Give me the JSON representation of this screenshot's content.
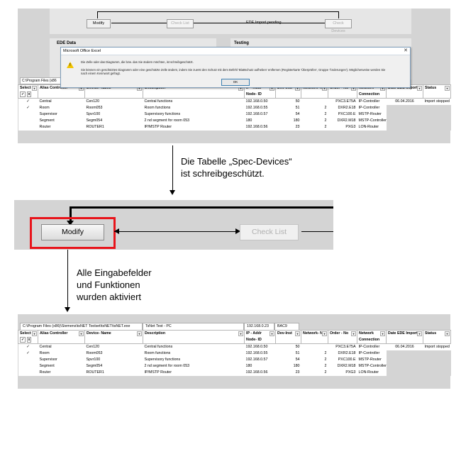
{
  "panel1": {
    "workflow": {
      "modify_label": "Modify",
      "checklist_label": "Check List",
      "ede_status_label": "EDE Import pending",
      "check_devices_label": "Check Devices"
    },
    "ede_data_label": "EDE Data",
    "testing_label": "Testing",
    "path_prefix": "C:\\Program Files (x86",
    "dialog": {
      "title": "Microsoft Office Excel",
      "message_line1": "Die Zelle oder das Diagramm, die bzw. das Sie ändern möchten, ist schreibgeschützt.",
      "message_line2": "Sie können ein geschütztes Diagramm oder eine geschützte Zelle ändern, indem Sie zuerst den Schutz mit dem Befehl 'Blattschutz aufheben' entfernen (Registerkarte 'Überprüfen', Gruppe 'Änderungen'). Möglicherweise werden Sie",
      "message_line3": "nach einem Kennwort gefragt.",
      "ok_label": "OK",
      "close_symbol": "✕",
      "warning_glyph": "!"
    }
  },
  "columns": {
    "select": "Select",
    "alias": "Alias Controller",
    "device": "Device- Name",
    "description": "Description",
    "ip": "IP - Addr",
    "ip2": "Node- ID",
    "devinst": "Dev-Inst",
    "network": "Network- N",
    "order": "Order - No",
    "netconn": "Network",
    "netconn2": "Connection",
    "date": "Date EDE Import",
    "status": "Status"
  },
  "select_marks": {
    "check": "✓",
    "x": "x"
  },
  "rows_locked": [
    {
      "select": "✓",
      "alias": "Central",
      "device": "Cen120",
      "description": "Central functions",
      "ip": "192.168.0.50",
      "devinst": "50",
      "network": "",
      "order": "PXC3.E75A",
      "netconn": "IP-Controller",
      "date": "06.04.2016",
      "status": "Import stopped"
    },
    {
      "select": "✓",
      "alias": "Room",
      "device": "Room053",
      "description": "Room functions",
      "ip": "192.168.0.55",
      "devinst": "51",
      "network": "2",
      "order": "DXR2.E18",
      "netconn": "IP-Controller",
      "date": "",
      "status": ""
    },
    {
      "select": "",
      "alias": "Supervisor",
      "device": "Spvr100",
      "description": "Supervisory functions",
      "ip": "192.168.0.57",
      "devinst": "54",
      "network": "2",
      "order": "PXC100.E",
      "netconn": "MSTP-Router",
      "date": "",
      "status": ""
    },
    {
      "select": "",
      "alias": "Segment",
      "device": "Segm054",
      "description": "2 nd segment for room 053",
      "ip": "180",
      "devinst": "180",
      "network": "2",
      "order": "DXR2.M18",
      "netconn": "MSTP-Controller",
      "date": "",
      "status": ""
    },
    {
      "select": "",
      "alias": "Router",
      "device": "ROUTER1",
      "description": "IP/MSTP Router",
      "ip": "192.168.0.56",
      "devinst": "23",
      "network": "2",
      "order": "PXG3",
      "netconn": "LON-Router",
      "date": "",
      "status": ""
    }
  ],
  "annotation1": {
    "line1": "Die Tabelle „Spec-Devices“",
    "line2": "ist schreibgeschützt."
  },
  "panel2": {
    "modify_label": "Modify",
    "checklist_label": "Check List"
  },
  "annotation2": {
    "line1": "Alle Eingabefelder",
    "line2": "und Funktionen",
    "line3": "wurden aktiviert"
  },
  "panel3": {
    "path": "C:\\Program Files (x86)\\Siemens\\tsNET Toolset\\tsNET\\tsNET.exe",
    "project": "TsNet Test - PC",
    "ip_field": "192.168.0.23",
    "bac_field": "BAC9"
  },
  "rows_active": [
    {
      "select": "✓",
      "alias": "Central",
      "device": "Cen120",
      "description": "Central functions",
      "ip": "192.168.0.50",
      "devinst": "50",
      "network": "",
      "order": "PXC3.E75A",
      "netconn": "IP-Controller",
      "date": "06.04.2016",
      "status": "Import stopped"
    },
    {
      "select": "✓",
      "alias": "Room",
      "device": "Room053",
      "description": "Room functions",
      "ip": "192.168.0.55",
      "devinst": "51",
      "network": "2",
      "order": "DXR2.E18",
      "netconn": "IP-Controller",
      "date": "",
      "status": ""
    },
    {
      "select": "",
      "alias": "Supervisor",
      "device": "Spvr100",
      "description": "Supervisory functions",
      "ip": "192.168.0.57",
      "devinst": "54",
      "network": "2",
      "order": "PXC100.E",
      "netconn": "MSTP-Router",
      "date": "",
      "status": ""
    },
    {
      "select": "",
      "alias": "Segment",
      "device": "Segm054",
      "description": "2 nd segment for room 053",
      "ip": "180",
      "devinst": "180",
      "network": "2",
      "order": "DXR2.M18",
      "netconn": "MSTP-Controller",
      "date": "",
      "status": ""
    },
    {
      "select": "",
      "alias": "Router",
      "device": "ROUTER1",
      "description": "IP/MSTP Router",
      "ip": "192.168.0.56",
      "devinst": "23",
      "network": "2",
      "order": "PXG3",
      "netconn": "LON-Router",
      "date": "",
      "status": ""
    }
  ],
  "dropdown_glyph": "▾"
}
